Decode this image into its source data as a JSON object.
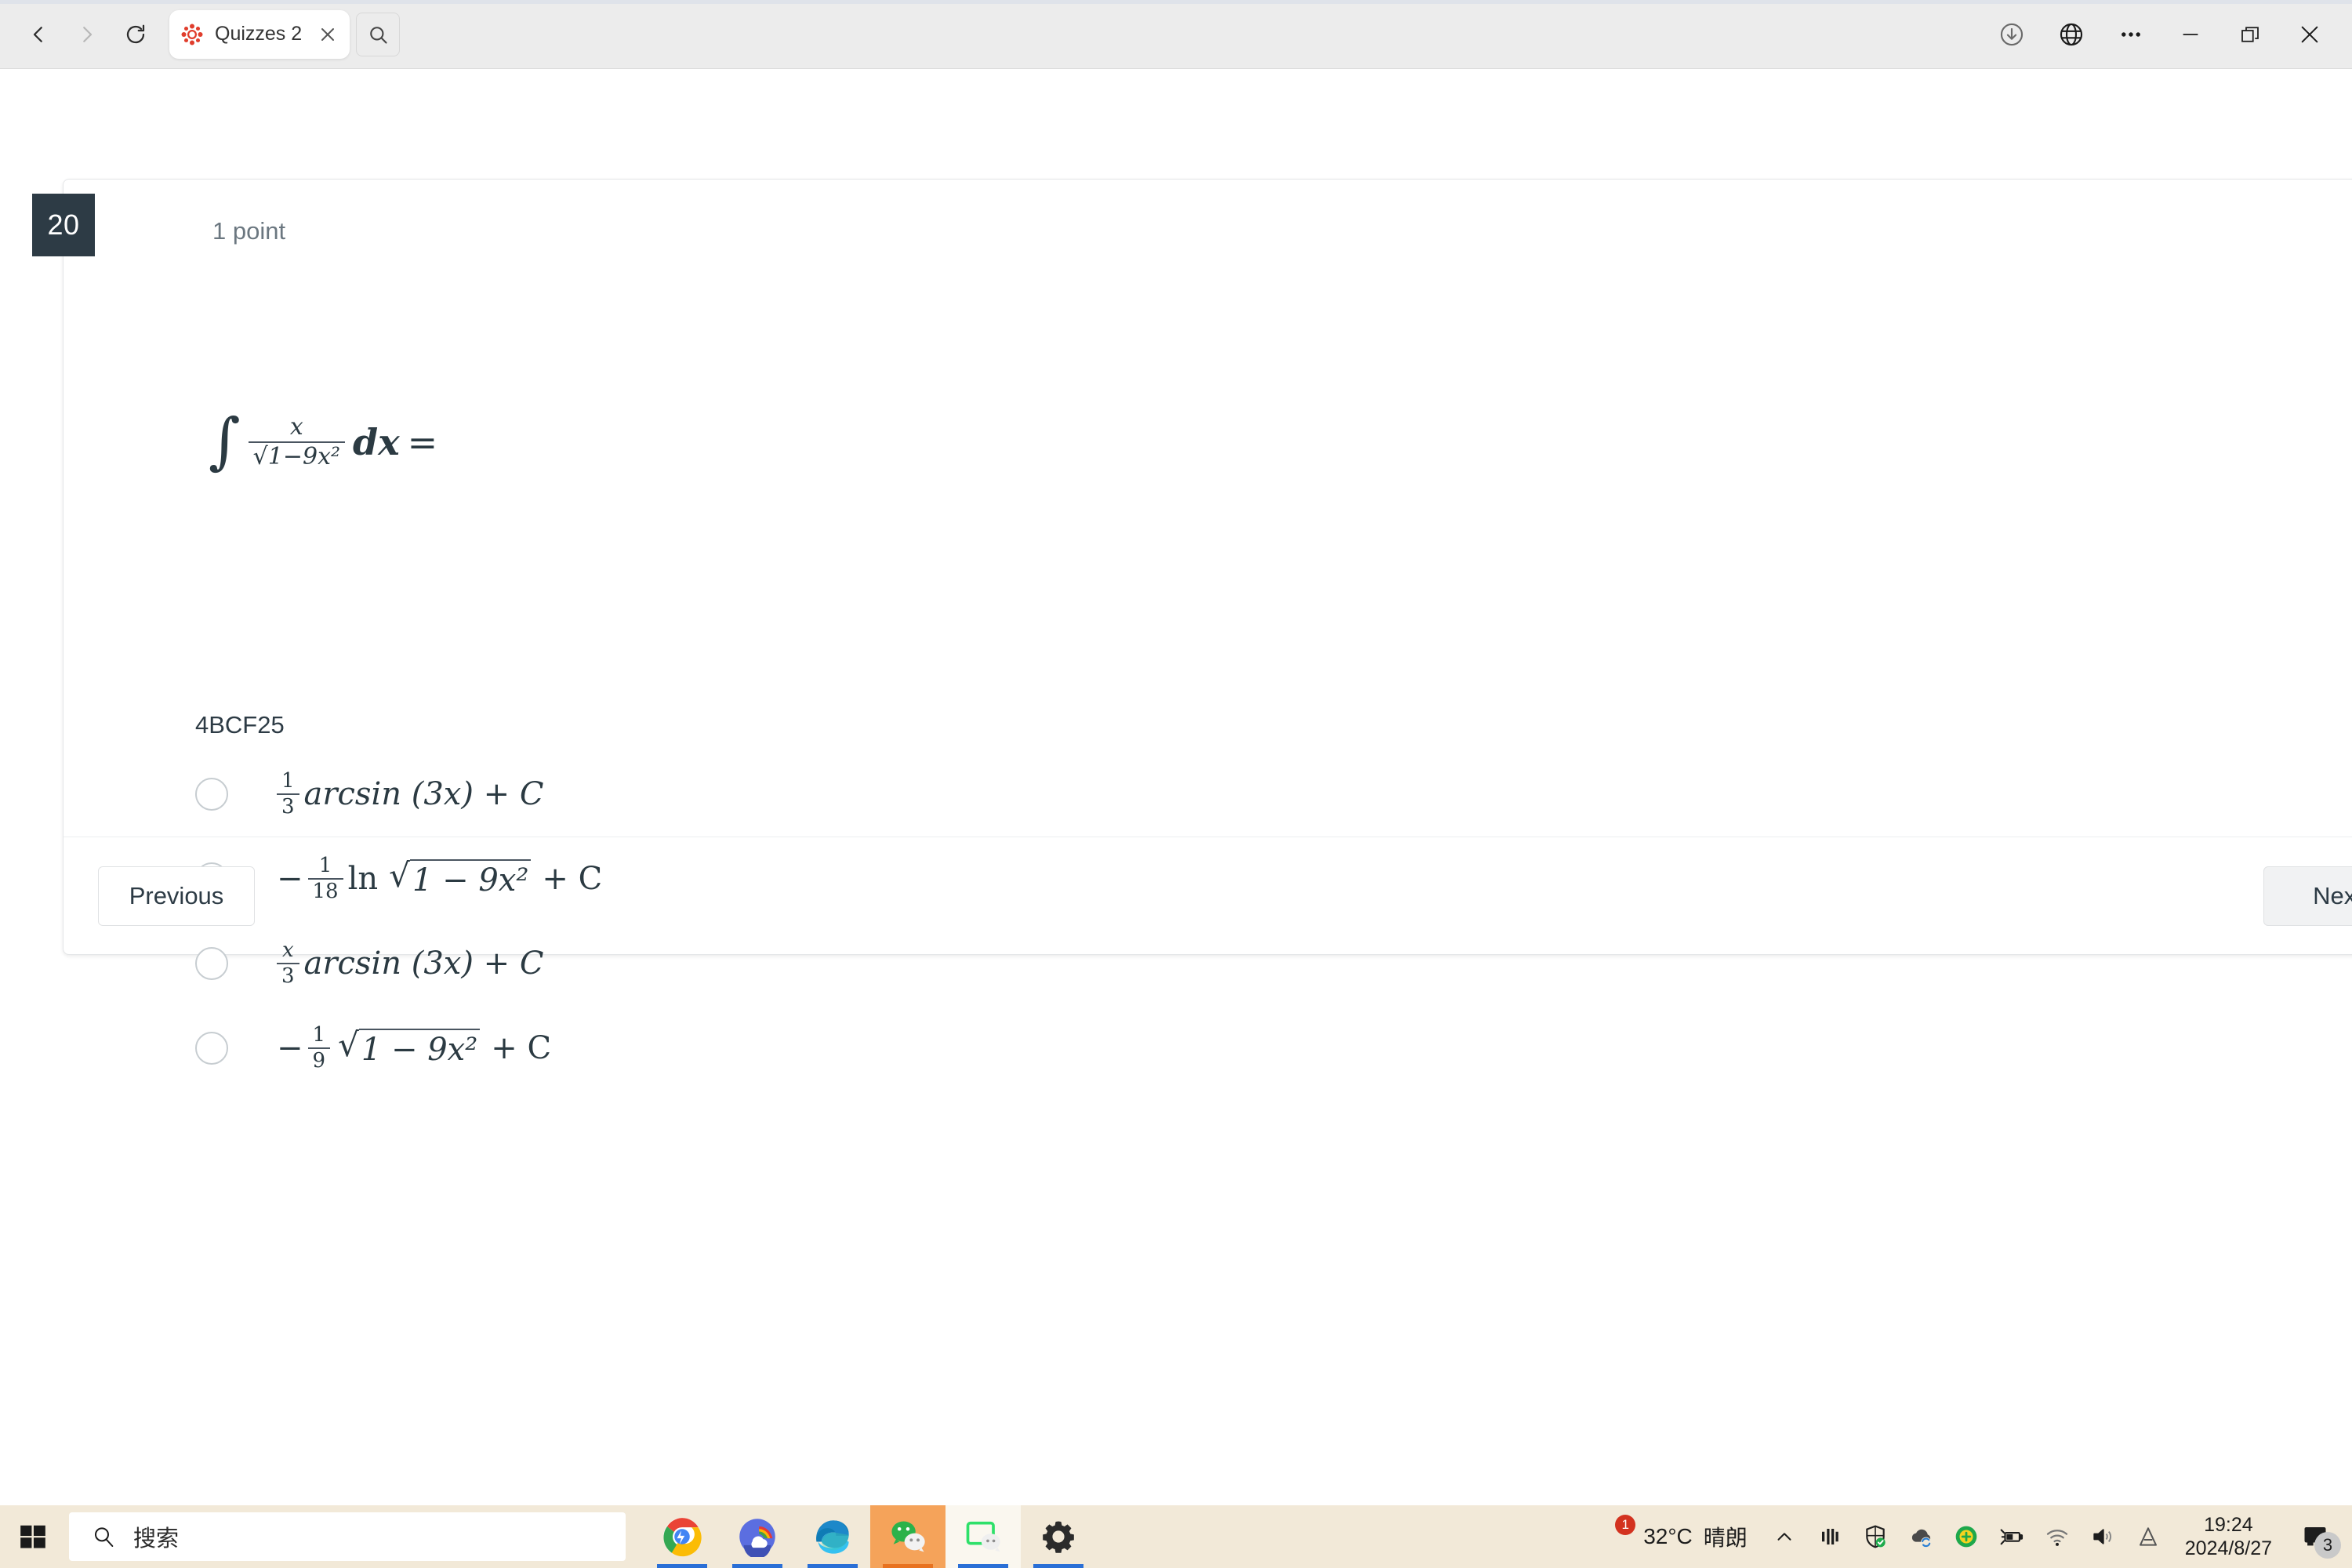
{
  "browser": {
    "back_icon": "back-arrow-icon",
    "forward_icon": "forward-arrow-icon",
    "reload_icon": "reload-icon",
    "tab": {
      "title": "Quizzes 2",
      "favicon": "canvas-lms-favicon",
      "close_icon": "close-icon"
    },
    "tab_search_icon": "search-icon",
    "right_icons": [
      "download-icon",
      "globe-icon",
      "more-options-icon",
      "minimize-icon",
      "restore-icon",
      "close-window-icon"
    ]
  },
  "quiz": {
    "question_number": "20",
    "points_label": "1 point",
    "flag_icon": "flag-icon",
    "formula": {
      "integral_sign": "∫",
      "numerator": "x",
      "radical": "√",
      "radicand": "1−9x²",
      "differential": "dx",
      "equals": "="
    },
    "answer_code": "4BCF25",
    "options": [
      {
        "id": "option-1",
        "sign": "",
        "frac_num": "1",
        "frac_den": "3",
        "body": "arcsin (3x) + C",
        "selected": false
      },
      {
        "id": "option-2",
        "sign": "−",
        "frac_num": "1",
        "frac_den": "18",
        "body": "ln",
        "radical": "√",
        "radicand": "1 − 9x²",
        "tail": "+ C",
        "selected": false
      },
      {
        "id": "option-3",
        "sign": "",
        "frac_num": "x",
        "frac_den": "3",
        "body": "arcsin (3x) + C",
        "selected": false
      },
      {
        "id": "option-4",
        "sign": "−",
        "frac_num": "1",
        "frac_den": "9",
        "body": "",
        "radical": "√",
        "radicand": "1 − 9x²",
        "tail": "+ C",
        "selected": false
      }
    ],
    "previous_label": "Previous",
    "next_label": "Next"
  },
  "taskbar": {
    "start_icon": "windows-start-icon",
    "search_icon": "search-icon",
    "search_placeholder": "搜索",
    "apps": [
      {
        "name": "google-chrome",
        "running": true
      },
      {
        "name": "weather-app",
        "running": true
      },
      {
        "name": "microsoft-edge",
        "running": true
      },
      {
        "name": "wechat",
        "running": true,
        "active": true
      },
      {
        "name": "wechat-desktop",
        "running": true
      },
      {
        "name": "settings",
        "running": true
      }
    ],
    "weather": {
      "temperature": "32°C",
      "condition": "晴朗",
      "badge_count": "1"
    },
    "tray_icons": [
      "show-hidden-icons-chevron",
      "sound-mixer-icon",
      "windows-security-icon",
      "onedrive-sync-icon",
      "add-on-icon",
      "battery-charging-icon",
      "wifi-icon",
      "volume-icon",
      "ime-language-icon"
    ],
    "clock": {
      "time": "19:24",
      "date": "2024/8/27"
    },
    "notification_count": "3"
  },
  "colors": {
    "badge_dark": "#2D3B45",
    "taskbar": "#f2e9d8",
    "chrome_bg": "#ececec",
    "accent_blue": "#2a6fd6"
  }
}
